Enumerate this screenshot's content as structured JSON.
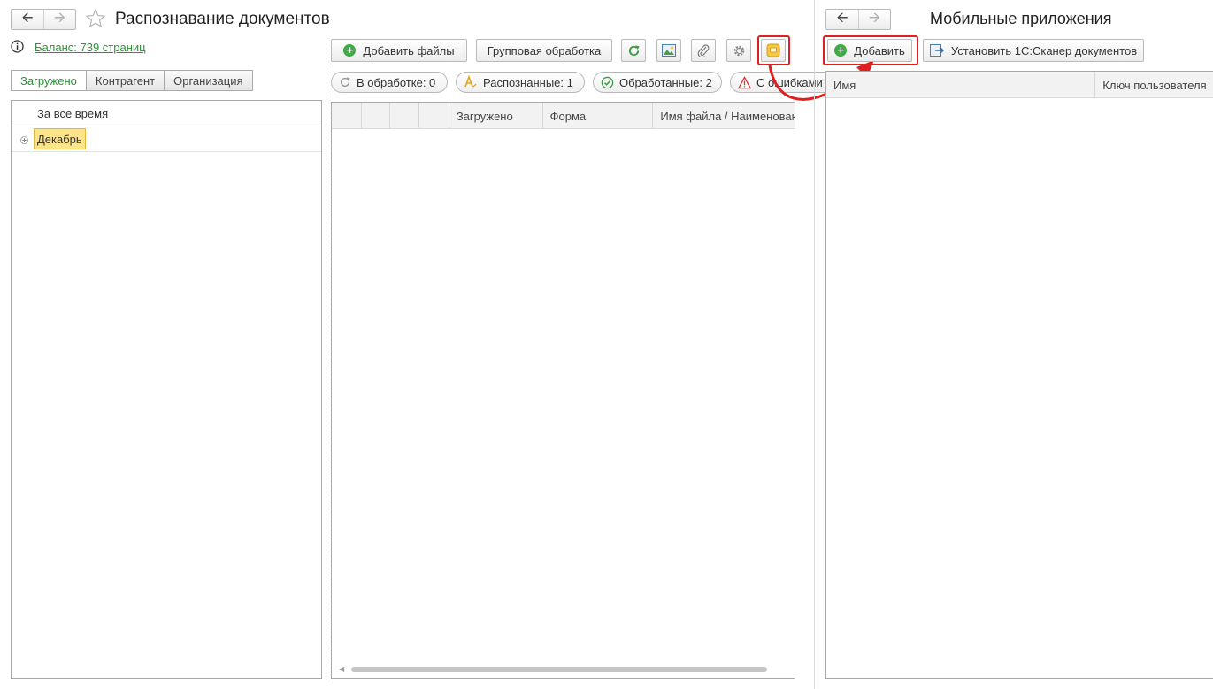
{
  "left_window": {
    "title": "Распознавание документов",
    "balance_link": "Баланс: 739 страниц",
    "tabs": [
      "Загружено",
      "Контрагент",
      "Организация"
    ],
    "tree": {
      "header": "За все время",
      "items": [
        {
          "label": "Декабрь"
        }
      ]
    },
    "toolbar": {
      "add_files": "Добавить файлы",
      "group_processing": "Групповая обработка"
    },
    "filters": [
      {
        "label": "В обработке: 0",
        "icon": "refresh-icon"
      },
      {
        "label": "Распознанные: 1",
        "icon": "recognized-icon"
      },
      {
        "label": "Обработанные: 2",
        "icon": "check-circle-icon"
      },
      {
        "label": "С ошибками",
        "icon": "warning-icon"
      }
    ],
    "grid_columns": [
      "",
      "",
      "",
      "",
      "Загружено",
      "Форма",
      "Имя файла / Наименование"
    ]
  },
  "right_window": {
    "title": "Мобильные приложения",
    "toolbar": {
      "add": "Добавить",
      "install": "Установить 1С:Сканер документов"
    },
    "grid_columns": [
      "Имя",
      "Ключ пользователя"
    ]
  },
  "colors": {
    "accent_green": "#2f8f3a",
    "highlight_red": "#e02020",
    "tree_selected": "#fde38a"
  }
}
